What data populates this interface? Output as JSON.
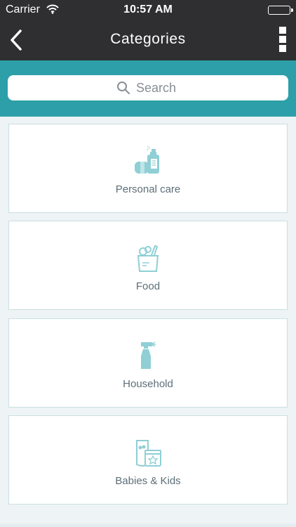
{
  "status_bar": {
    "carrier": "Carrier",
    "time": "10:57 AM"
  },
  "nav": {
    "title": "Categories",
    "back_icon": "chevron-left-icon",
    "menu_icon": "more-vertical-icon"
  },
  "search": {
    "placeholder": "Search",
    "icon": "search-icon"
  },
  "categories": [
    {
      "label": "Personal care",
      "icon": "personal-care-icon"
    },
    {
      "label": "Food",
      "icon": "grocery-bag-icon"
    },
    {
      "label": "Household",
      "icon": "spray-bottle-icon"
    },
    {
      "label": "Babies & Kids",
      "icon": "baby-products-icon"
    }
  ],
  "colors": {
    "nav_background": "#2f2f31",
    "search_band": "#2d9fa8",
    "icon_tint": "#8fcfd5",
    "label_text": "#5d6e78",
    "card_border": "#c9dfe2"
  }
}
